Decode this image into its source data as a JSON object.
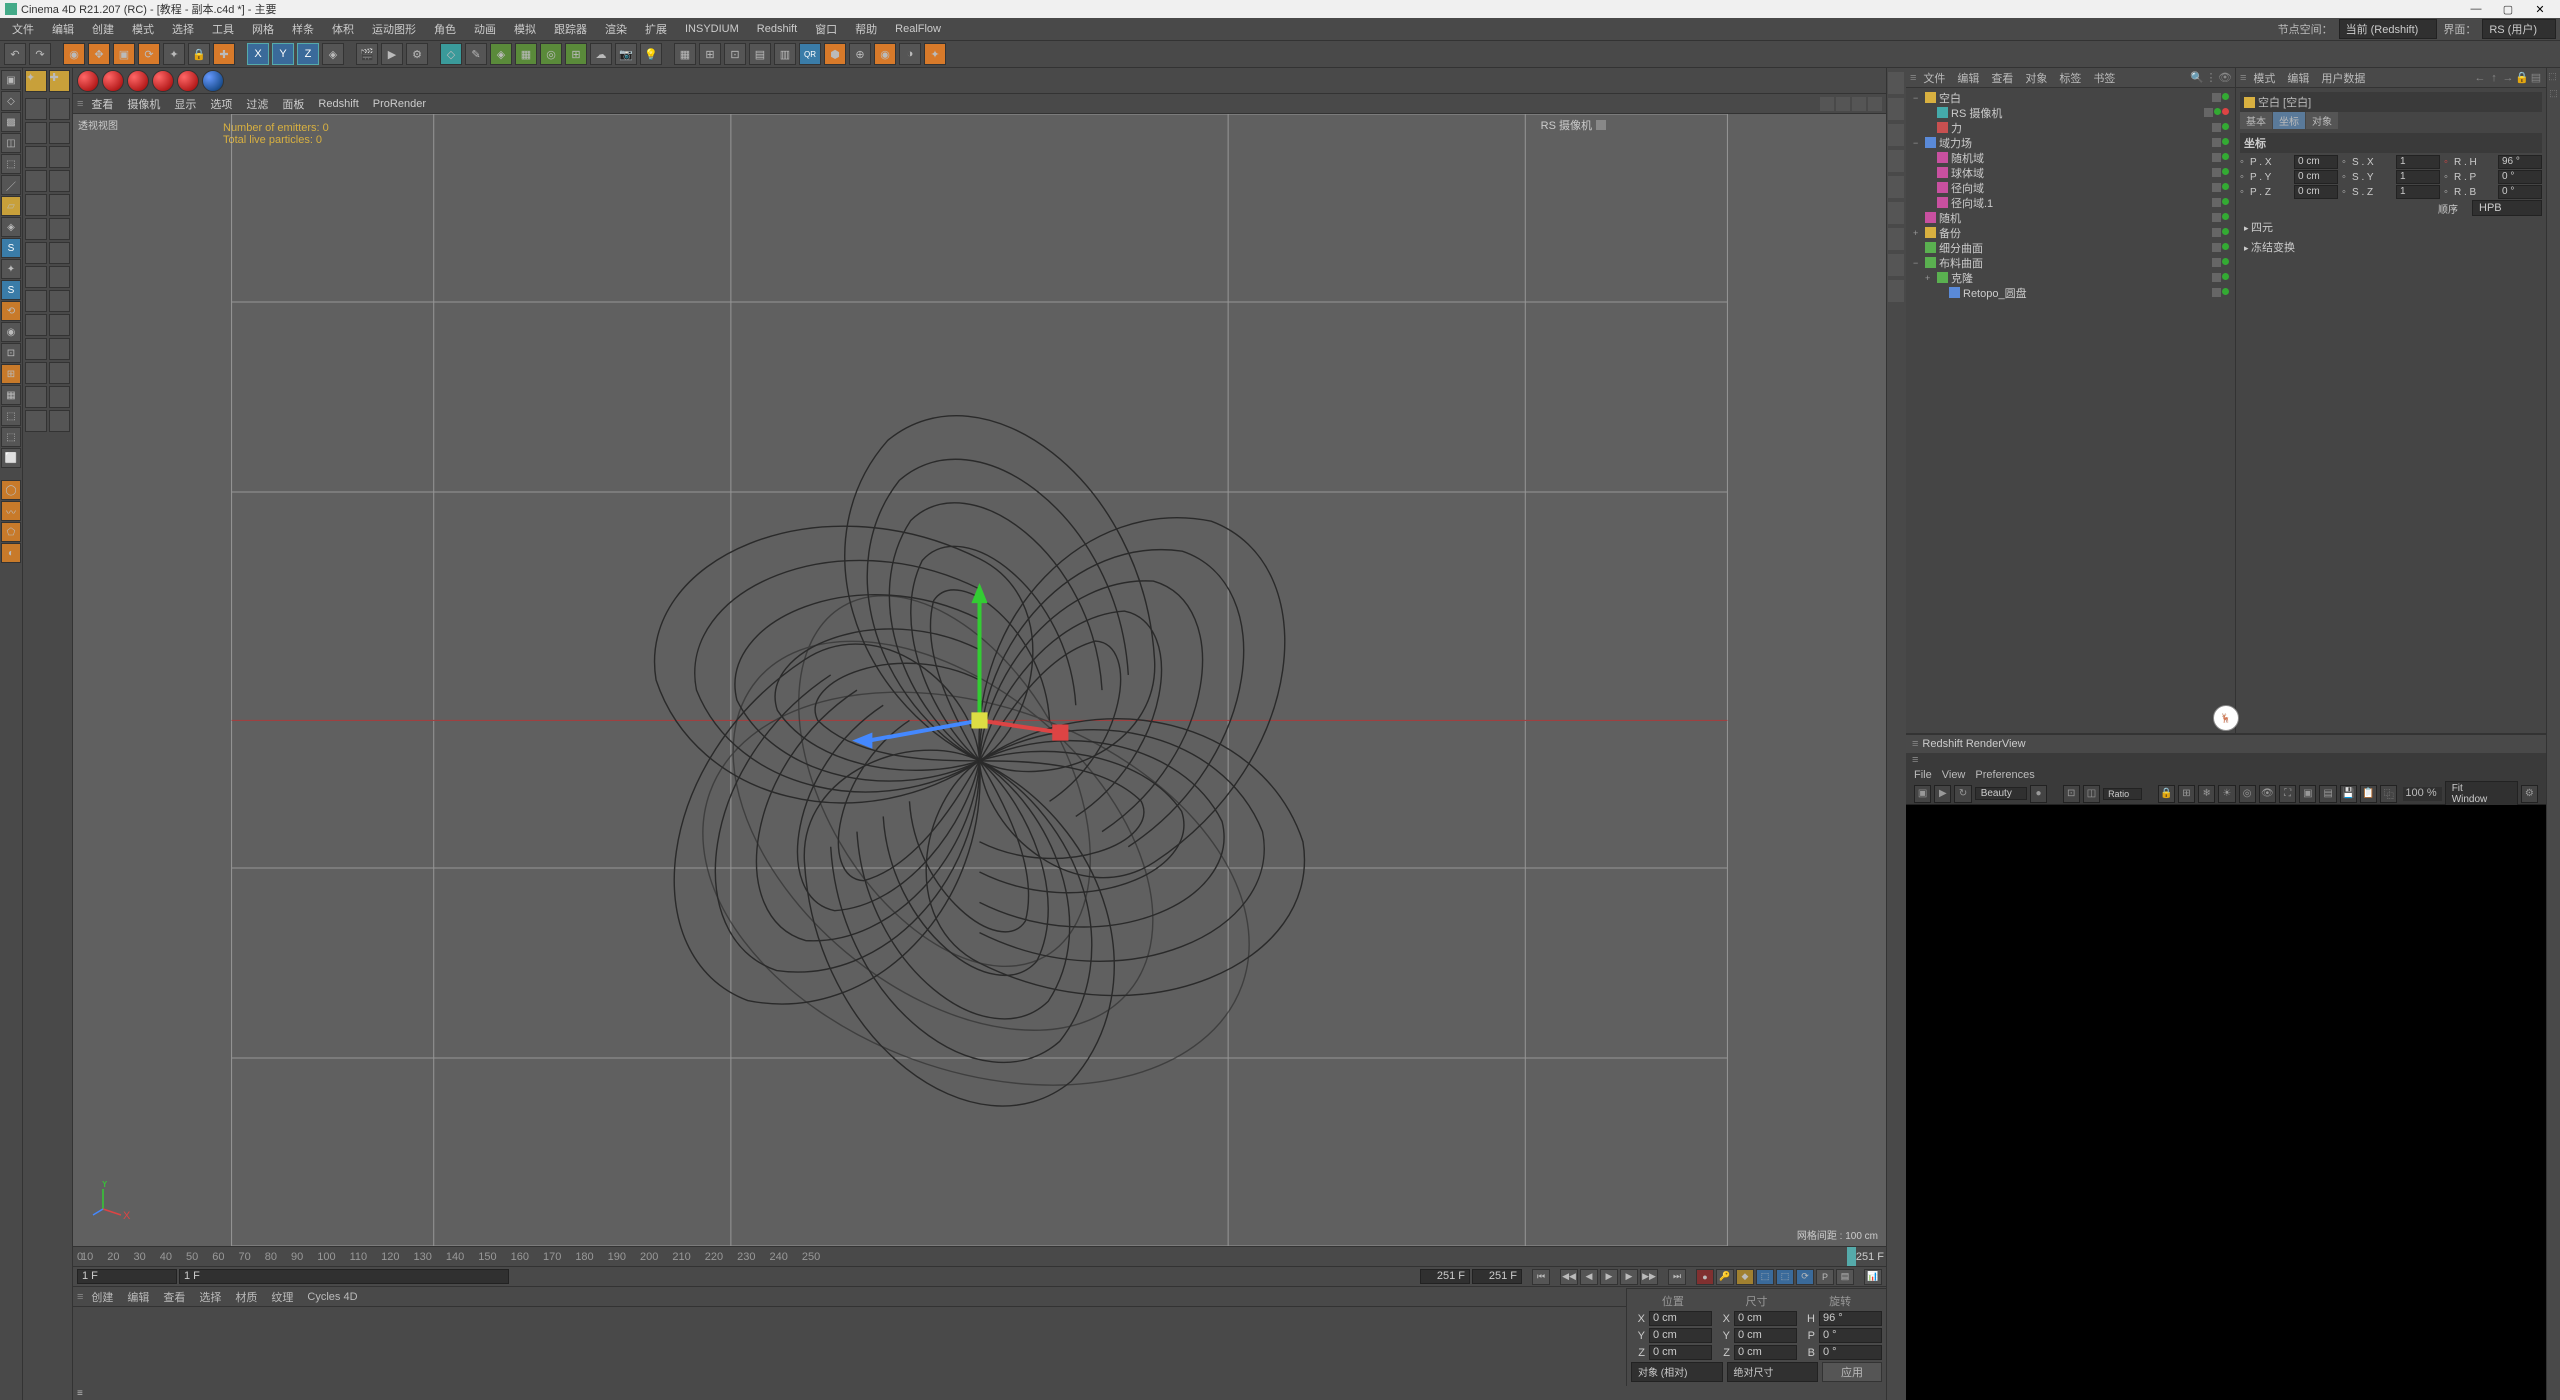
{
  "app": {
    "title": "Cinema 4D R21.207 (RC) - [教程 - 副本.c4d *] - 主要"
  },
  "menubar": {
    "items": [
      "文件",
      "编辑",
      "创建",
      "模式",
      "选择",
      "工具",
      "网格",
      "样条",
      "体积",
      "运动图形",
      "角色",
      "动画",
      "模拟",
      "跟踪器",
      "渲染",
      "扩展",
      "INSYDIUM",
      "Redshift",
      "窗口",
      "帮助",
      "RealFlow"
    ],
    "right": {
      "node_space_label": "节点空间：",
      "node_space_value": "当前 (Redshift)",
      "layout_label": "界面：",
      "layout_value": "RS (用户)"
    }
  },
  "viewport": {
    "menu": [
      "查看",
      "摄像机",
      "显示",
      "选项",
      "过滤",
      "面板",
      "Redshift",
      "ProRender"
    ],
    "label": "透视视图",
    "camera": "RS 摄像机",
    "hud": {
      "emitters": "Number of emitters: 0",
      "particles": "Total live particles: 0"
    },
    "grid_info": "网格间距 : 100 cm"
  },
  "timeline": {
    "ticks": [
      "10",
      "20",
      "30",
      "40",
      "50",
      "60",
      "70",
      "80",
      "90",
      "100",
      "110",
      "120",
      "130",
      "140",
      "150",
      "160",
      "170",
      "180",
      "190",
      "200",
      "210",
      "220",
      "230",
      "240",
      "250"
    ],
    "marker": "251 F",
    "start": "1 F",
    "current": "1 F",
    "end": "251 F",
    "total": "251 F"
  },
  "materialbar": {
    "items": [
      "创建",
      "编辑",
      "查看",
      "选择",
      "材质",
      "纹理",
      "Cycles 4D"
    ]
  },
  "coord": {
    "headers": [
      "位置",
      "尺寸",
      "旋转"
    ],
    "rows": [
      {
        "axis": "X",
        "pos": "0 cm",
        "axis2": "X",
        "size": "0 cm",
        "rot_axis": "H",
        "rot": "96 °"
      },
      {
        "axis": "Y",
        "pos": "0 cm",
        "axis2": "Y",
        "size": "0 cm",
        "rot_axis": "P",
        "rot": "0 °"
      },
      {
        "axis": "Z",
        "pos": "0 cm",
        "axis2": "Z",
        "size": "0 cm",
        "rot_axis": "B",
        "rot": "0 °"
      }
    ],
    "mode1": "对象 (相对)",
    "mode2": "绝对尺寸",
    "apply": "应用"
  },
  "objects": {
    "menu": [
      "文件",
      "编辑",
      "查看",
      "对象",
      "标签",
      "书签"
    ],
    "tree": [
      {
        "indent": 0,
        "expand": "−",
        "icon": "#d8b040",
        "label": "空白"
      },
      {
        "indent": 1,
        "expand": "",
        "icon": "#4aa",
        "label": "RS 摄像机",
        "extra": "red"
      },
      {
        "indent": 1,
        "expand": "",
        "icon": "#c85050",
        "label": "力"
      },
      {
        "indent": 0,
        "expand": "−",
        "icon": "#5a8ad8",
        "label": "域力场"
      },
      {
        "indent": 1,
        "expand": "",
        "icon": "#c850a0",
        "label": "随机域"
      },
      {
        "indent": 1,
        "expand": "",
        "icon": "#c850a0",
        "label": "球体域"
      },
      {
        "indent": 1,
        "expand": "",
        "icon": "#c850a0",
        "label": "径向域"
      },
      {
        "indent": 1,
        "expand": "",
        "icon": "#c850a0",
        "label": "径向域.1"
      },
      {
        "indent": 0,
        "expand": "",
        "icon": "#c850a0",
        "label": "随机"
      },
      {
        "indent": 0,
        "expand": "+",
        "icon": "#d8b040",
        "label": "备份"
      },
      {
        "indent": 0,
        "expand": "",
        "icon": "#5ab050",
        "label": "细分曲面"
      },
      {
        "indent": 0,
        "expand": "−",
        "icon": "#5ab050",
        "label": "布料曲面"
      },
      {
        "indent": 1,
        "expand": "+",
        "icon": "#5ab050",
        "label": "克隆"
      },
      {
        "indent": 2,
        "expand": "",
        "icon": "#5a8ad8",
        "label": "Retopo_圆盘"
      }
    ]
  },
  "attributes": {
    "menu": [
      "模式",
      "编辑",
      "用户数据"
    ],
    "title": "空白 [空白]",
    "tabs": [
      "基本",
      "坐标",
      "对象"
    ],
    "active_tab": 1,
    "section": "坐标",
    "coords": [
      {
        "l1": "P . X",
        "v1": "0 cm",
        "l2": "S . X",
        "v2": "1",
        "l3": "R . H",
        "v3": "96 °"
      },
      {
        "l1": "P . Y",
        "v1": "0 cm",
        "l2": "S . Y",
        "v2": "1",
        "l3": "R . P",
        "v3": "0 °"
      },
      {
        "l1": "P . Z",
        "v1": "0 cm",
        "l2": "S . Z",
        "v2": "1",
        "l3": "R . B",
        "v3": "0 °"
      }
    ],
    "order_label": "顺序",
    "order_value": "HPB",
    "groups": [
      "四元",
      "冻结变换"
    ]
  },
  "renderview": {
    "title": "Redshift RenderView",
    "menu": [
      "File",
      "View",
      "Preferences"
    ],
    "aov": "Beauty",
    "zoom": "100 %",
    "fit": "Fit Window"
  }
}
